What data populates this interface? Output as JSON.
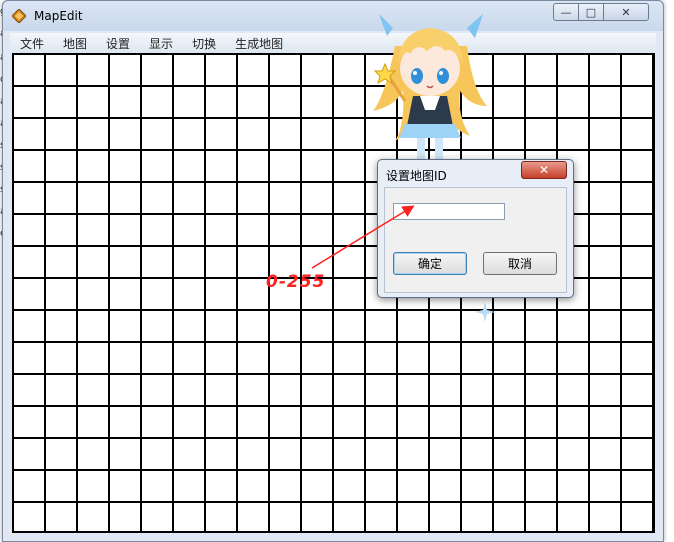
{
  "window": {
    "title": "MapEdit"
  },
  "caption_buttons": {
    "minimize": "—",
    "maximize": "□",
    "close": "✕"
  },
  "menu": [
    "文件",
    "地图",
    "设置",
    "显示",
    "切换",
    "生成地图"
  ],
  "dialog": {
    "title": "设置地图ID",
    "close": "✕",
    "input_value": "",
    "ok_label": "确定",
    "cancel_label": "取消"
  },
  "annotation": {
    "text": "0-255",
    "color": "#ff2020"
  },
  "background_edge_text": [
    "g",
    "a",
    "a",
    "o",
    "a",
    "a",
    "s",
    "s",
    "s",
    "a",
    "e"
  ],
  "icons": {
    "app": "mapedit-app-icon",
    "mascot": "anime-girl-mascot"
  }
}
